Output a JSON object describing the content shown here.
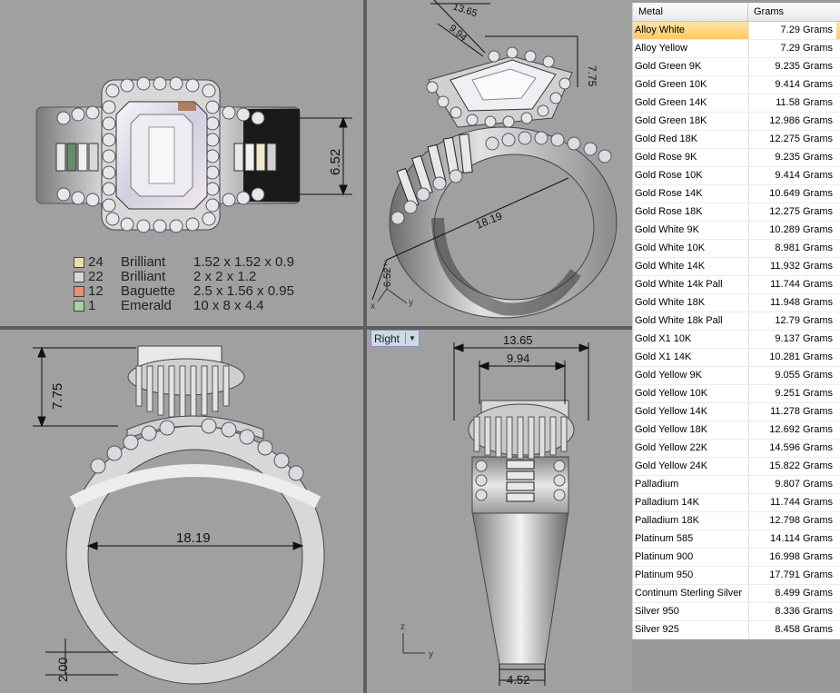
{
  "viewport_label": "Right",
  "dims": {
    "top_height": "6.52",
    "persp_width_outer": "13.65",
    "persp_width_inner": "9.94",
    "persp_height": "7.75",
    "persp_band": "18.19",
    "persp_small": "6.52",
    "front_height": "7.75",
    "front_inner": "18.19",
    "front_shank": "2.00",
    "right_outer": "13.65",
    "right_inner": "9.94",
    "right_shank": "4.52"
  },
  "axes": {
    "z": "z",
    "y": "y",
    "x": "x"
  },
  "legend": [
    {
      "count": "24",
      "type": "Brilliant",
      "size": "1.52 x 1.52 x 0.9",
      "color": "#e8e0a0"
    },
    {
      "count": "22",
      "type": "Brilliant",
      "size": "2 x 2 x 1.2",
      "color": "#d8d8d8"
    },
    {
      "count": "12",
      "type": "Baguette",
      "size": "2.5 x 1.56 x 0.95",
      "color": "#e8906a"
    },
    {
      "count": "1",
      "type": "Emerald",
      "size": "10 x 8 x 4.4",
      "color": "#a8d0a0"
    }
  ],
  "table": {
    "headers": [
      "Metal",
      "Grams"
    ],
    "rows": [
      [
        "Alloy White",
        "7.29 Grams"
      ],
      [
        "Alloy Yellow",
        "7.29 Grams"
      ],
      [
        "Gold Green 9K",
        "9.235 Grams"
      ],
      [
        "Gold Green 10K",
        "9.414 Grams"
      ],
      [
        "Gold Green 14K",
        "11.58 Grams"
      ],
      [
        "Gold Green 18K",
        "12.986 Grams"
      ],
      [
        "Gold Red 18K",
        "12.275 Grams"
      ],
      [
        "Gold Rose 9K",
        "9.235 Grams"
      ],
      [
        "Gold Rose 10K",
        "9.414 Grams"
      ],
      [
        "Gold Rose 14K",
        "10.649 Grams"
      ],
      [
        "Gold Rose 18K",
        "12.275 Grams"
      ],
      [
        "Gold White 9K",
        "10.289 Grams"
      ],
      [
        "Gold White 10K",
        "8.981 Grams"
      ],
      [
        "Gold White 14K",
        "11.932 Grams"
      ],
      [
        "Gold White 14k Pall",
        "11.744 Grams"
      ],
      [
        "Gold White 18K",
        "11.948 Grams"
      ],
      [
        "Gold White 18k Pall",
        "12.79 Grams"
      ],
      [
        "Gold X1 10K",
        "9.137 Grams"
      ],
      [
        "Gold X1 14K",
        "10.281 Grams"
      ],
      [
        "Gold Yellow 9K",
        "9.055 Grams"
      ],
      [
        "Gold Yellow 10K",
        "9.251 Grams"
      ],
      [
        "Gold Yellow 14K",
        "11.278 Grams"
      ],
      [
        "Gold Yellow 18K",
        "12.692 Grams"
      ],
      [
        "Gold Yellow 22K",
        "14.596 Grams"
      ],
      [
        "Gold Yellow 24K",
        "15.822 Grams"
      ],
      [
        "Palladium",
        "9.807 Grams"
      ],
      [
        "Palladium 14K",
        "11.744 Grams"
      ],
      [
        "Palladium 18K",
        "12.798 Grams"
      ],
      [
        "Platinum 585",
        "14.114 Grams"
      ],
      [
        "Platinum 900",
        "16.998 Grams"
      ],
      [
        "Platinum 950",
        "17.791 Grams"
      ],
      [
        "Continum Sterling Silver",
        "8.499 Grams"
      ],
      [
        "Silver 950",
        "8.336 Grams"
      ],
      [
        "Silver 925",
        "8.458 Grams"
      ]
    ],
    "selected_row": 0
  }
}
